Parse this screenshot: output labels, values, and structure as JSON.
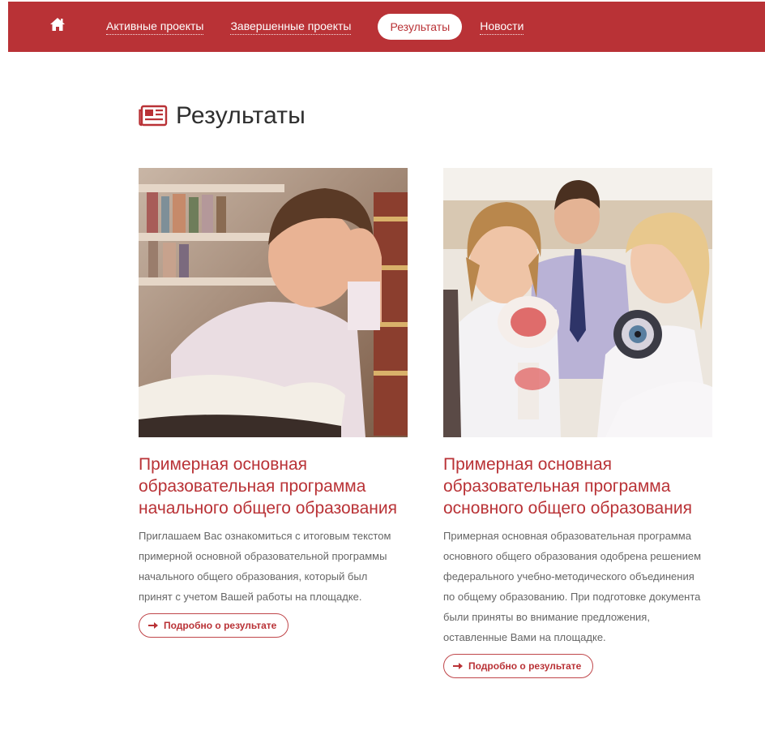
{
  "nav": {
    "home_icon": "home-icon",
    "items": [
      {
        "label": "Активные проекты"
      },
      {
        "label": "Завершенные проекты"
      },
      {
        "label": "Результаты",
        "active": true
      },
      {
        "label": "Новости"
      }
    ],
    "colors": {
      "bar": "#b93236",
      "text": "#ffffff"
    }
  },
  "page": {
    "title": "Результаты",
    "title_icon": "newspaper-icon"
  },
  "cards": [
    {
      "image": "boy-reading-book-photo",
      "title": "Примерная основная образовательная программа начального общего образования",
      "text": "Приглашаем Вас ознакомиться с итоговым текстом примерной основной образовательной программы начального общего образования, который был принят с учетом Вашей работы на площадке.",
      "button": "Подробно о результате"
    },
    {
      "image": "students-with-eye-model-photo",
      "title": "Примерная основная образовательная программа основного общего образования",
      "text": "Примерная основная образовательная программа основного общего образования одобрена решением федерального учебно-методического объединения по общему образованию. При подготовке документа были приняты во внимание предложения, оставленные Вами на площадке.",
      "button": "Подробно о результате"
    }
  ],
  "accent": "#b93236"
}
